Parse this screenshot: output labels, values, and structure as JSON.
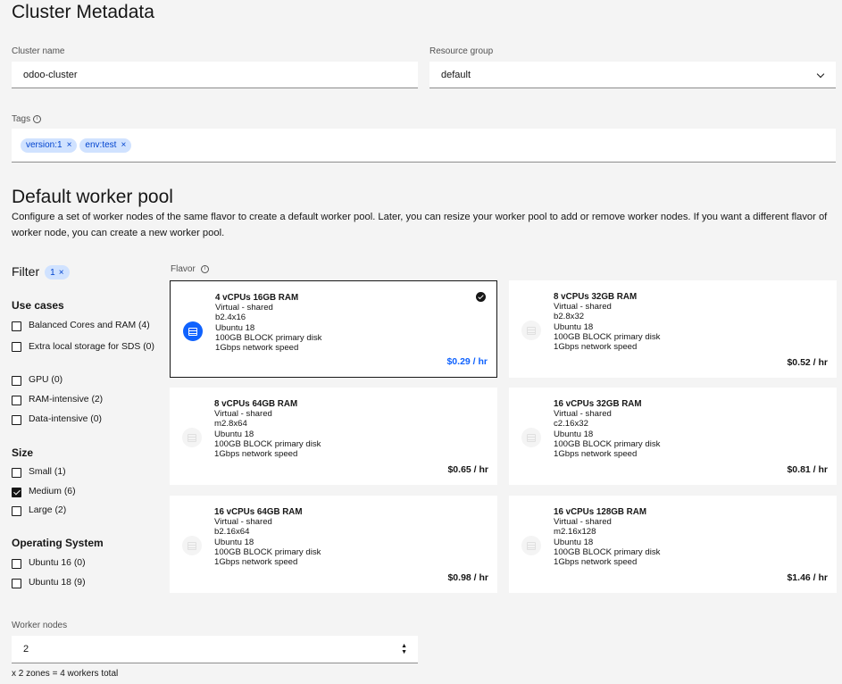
{
  "metadata": {
    "title": "Cluster Metadata",
    "cluster_name_label": "Cluster name",
    "cluster_name_value": "odoo-cluster",
    "resource_group_label": "Resource group",
    "resource_group_value": "default",
    "tags_label": "Tags",
    "tags": [
      "version:1",
      "env:test"
    ]
  },
  "worker_pool": {
    "title": "Default worker pool",
    "description": "Configure a set of worker nodes of the same flavor to create a default worker pool. Later, you can resize your worker pool to add or remove worker nodes. If you want a different flavor of worker node, you can create a new worker pool."
  },
  "filter": {
    "label": "Filter",
    "badge": "1",
    "groups": [
      {
        "title": "Use cases",
        "items": [
          {
            "label": "Balanced Cores and RAM (4)",
            "checked": false
          },
          {
            "label": "Extra local storage for SDS (0)",
            "checked": false
          },
          {
            "label": "GPU (0)",
            "checked": false
          },
          {
            "label": "RAM-intensive (2)",
            "checked": false
          },
          {
            "label": "Data-intensive (0)",
            "checked": false
          }
        ]
      },
      {
        "title": "Size",
        "items": [
          {
            "label": "Small (1)",
            "checked": false
          },
          {
            "label": "Medium (6)",
            "checked": true
          },
          {
            "label": "Large (2)",
            "checked": false
          }
        ]
      },
      {
        "title": "Operating System",
        "items": [
          {
            "label": "Ubuntu 16 (0)",
            "checked": false
          },
          {
            "label": "Ubuntu 18 (9)",
            "checked": false
          }
        ]
      }
    ]
  },
  "flavor": {
    "label": "Flavor",
    "cards": [
      {
        "title": "4 vCPUs 16GB RAM",
        "type": "Virtual - shared",
        "name": "b2.4x16",
        "os": "Ubuntu 18",
        "disk": "100GB BLOCK primary disk",
        "network": "1Gbps network speed",
        "price": "$0.29 / hr",
        "selected": true
      },
      {
        "title": "8 vCPUs 32GB RAM",
        "type": "Virtual - shared",
        "name": "b2.8x32",
        "os": "Ubuntu 18",
        "disk": "100GB BLOCK primary disk",
        "network": "1Gbps network speed",
        "price": "$0.52 / hr",
        "selected": false
      },
      {
        "title": "8 vCPUs 64GB RAM",
        "type": "Virtual - shared",
        "name": "m2.8x64",
        "os": "Ubuntu 18",
        "disk": "100GB BLOCK primary disk",
        "network": "1Gbps network speed",
        "price": "$0.65 / hr",
        "selected": false
      },
      {
        "title": "16 vCPUs 32GB RAM",
        "type": "Virtual - shared",
        "name": "c2.16x32",
        "os": "Ubuntu 18",
        "disk": "100GB BLOCK primary disk",
        "network": "1Gbps network speed",
        "price": "$0.81 / hr",
        "selected": false
      },
      {
        "title": "16 vCPUs 64GB RAM",
        "type": "Virtual - shared",
        "name": "b2.16x64",
        "os": "Ubuntu 18",
        "disk": "100GB BLOCK primary disk",
        "network": "1Gbps network speed",
        "price": "$0.98 / hr",
        "selected": false
      },
      {
        "title": "16 vCPUs 128GB RAM",
        "type": "Virtual - shared",
        "name": "m2.16x128",
        "os": "Ubuntu 18",
        "disk": "100GB BLOCK primary disk",
        "network": "1Gbps network speed",
        "price": "$1.46 / hr",
        "selected": false
      }
    ]
  },
  "workers": {
    "label": "Worker nodes",
    "value": "2",
    "helper": "x 2 zones = 4 workers total"
  },
  "colors": {
    "accent": "#0f62fe",
    "tag_bg": "#d0e2ff",
    "tag_fg": "#0043ce"
  }
}
